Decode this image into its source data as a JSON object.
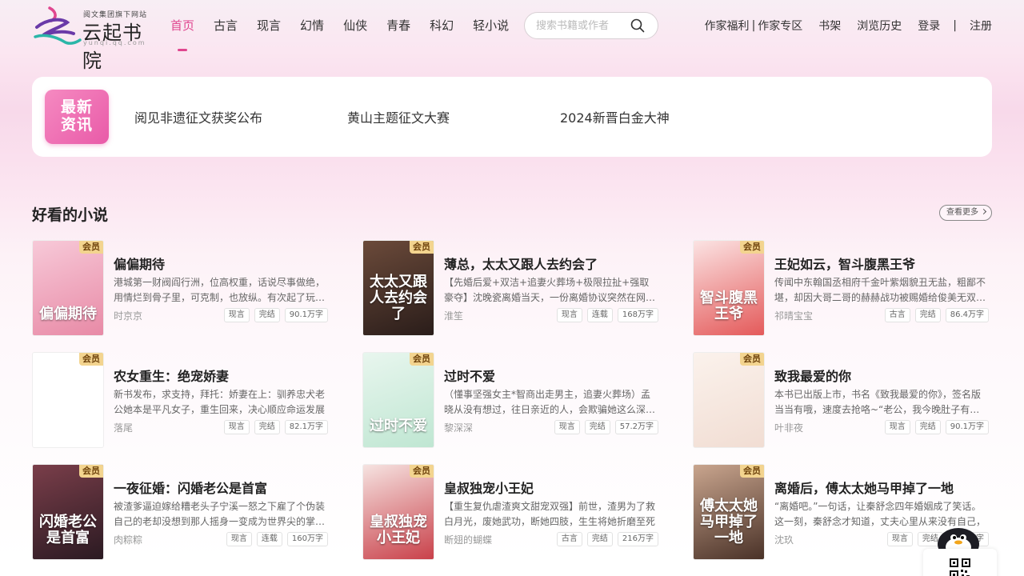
{
  "header": {
    "logo_tagline": "阅文集团旗下网站",
    "logo_brand": "云起书院",
    "logo_url": "yunqi.qq.com",
    "nav": [
      "首页",
      "古言",
      "现言",
      "幻情",
      "仙侠",
      "青春",
      "科幻",
      "轻小说"
    ],
    "active_nav": "首页",
    "search_placeholder": "搜索书籍或作者",
    "author_benefits": "作家福利",
    "author_zone": "作家专区",
    "pipe": "|",
    "bookshelf": "书架",
    "history": "浏览历史",
    "login": "登录",
    "register": "注册"
  },
  "news": {
    "badge_line1": "最新",
    "badge_line2": "资讯",
    "items": [
      "阅见非遗征文获奖公布",
      "黄山主题征文大赛",
      "2024新晋白金大神"
    ]
  },
  "section": {
    "title": "好看的小说",
    "more": "查看更多"
  },
  "vip_label": "会员",
  "books": [
    {
      "title": "偏偏期待",
      "cover_text": "偏偏期待",
      "desc": "港城第一财阀阎行洲，位高权重，话说尽事做绝，用情烂到骨子里，可克制，也放纵。有次起了玩心，",
      "author": "时京京",
      "tags": [
        "现言",
        "完结",
        "90.1万字"
      ],
      "cover_colors": [
        "#f7c9d8",
        "#e88aa6"
      ]
    },
    {
      "title": "薄总，太太又跟人去约会了",
      "cover_text": "太太又跟人去约会了",
      "desc": "【先婚后爱+双洁+追妻火葬场+极限拉扯+强取豪夺】沈晚瓷离婚当天，一份离婚协议突然在网络上曝光",
      "author": "淮笙",
      "tags": [
        "现言",
        "连载",
        "168万字"
      ],
      "cover_colors": [
        "#6b4a3a",
        "#2a1d1a"
      ]
    },
    {
      "title": "王妃如云，智斗腹黑王爷",
      "cover_text": "智斗腹黑王爷",
      "desc": "传闻中东翰国丞相府千金叶紫烟貌丑无盐，粗鄙不堪，却因大哥二哥的赫赫战功被赐婚给俊美无双的王爷",
      "author": "祁晴宝宝",
      "tags": [
        "古言",
        "完结",
        "86.4万字"
      ],
      "cover_colors": [
        "#fbe3e3",
        "#e45a5a"
      ]
    },
    {
      "title": "农女重生：绝宠娇妻",
      "cover_text": "",
      "desc": "新书发布，求支持，拜托：娇妻在上：驯养忠犬老公她本是平凡女子，重生回来，决心顺应命运发展",
      "author": "落尾",
      "tags": [
        "现言",
        "完结",
        "82.1万字"
      ],
      "cover_colors": [
        "#ffffff",
        "#ffffff"
      ]
    },
    {
      "title": "过时不爱",
      "cover_text": "过时不爱",
      "desc": "（懂事坚强女主*智商出走男主，追妻火葬场）孟晓从没有想过，往日亲近的人，会欺骗她这么深。初恋",
      "author": "黎深深",
      "tags": [
        "现言",
        "完结",
        "57.2万字"
      ],
      "cover_colors": [
        "#e8f6ee",
        "#bfe6d2"
      ]
    },
    {
      "title": "致我最爱的你",
      "cover_text": "",
      "desc": "本书已出版上市，书名《致我最爱的你》，签名版当当有哦，速度去抢咯~“老公，我今晚肚子有些疼”",
      "author": "叶非夜",
      "tags": [
        "现言",
        "完结",
        "90.1万字"
      ],
      "cover_colors": [
        "#fbf2ec",
        "#f1ddd3"
      ]
    },
    {
      "title": "一夜征婚：闪婚老公是首富",
      "cover_text": "闪婚老公是首富",
      "desc": "被渣爹逼迫嫁给糟老头子宁溪一怒之下雇了个伪装自己的老却没想到那人摇身一变成为世界尖的掌权者",
      "author": "肉粽粽",
      "tags": [
        "现言",
        "连载",
        "160万字"
      ],
      "cover_colors": [
        "#7a3e4a",
        "#2b1a22"
      ]
    },
    {
      "title": "皇叔独宠小王妃",
      "cover_text": "皇叔独宠小王妃",
      "desc": "【重生复仇虐渣爽文甜宠双强】前世，渣男为了救白月光，废她武功，断她四肢，生生将她折磨至死",
      "author": "断翅的蝴蝶",
      "tags": [
        "古言",
        "完结",
        "216万字"
      ],
      "cover_colors": [
        "#f6e3e1",
        "#c9414a"
      ]
    },
    {
      "title": "离婚后，傅太太她马甲掉了一地",
      "cover_text": "傅太太她马甲掉了一地",
      "desc": "“离婚吧。”一句话，让秦舒念四年婚姻成了笑话。这一刻，秦舒念才知道，丈夫心里从来没有自己，",
      "author": "沈玖",
      "tags": [
        "现言",
        "完结",
        "160万字"
      ],
      "cover_colors": [
        "#c9a58e",
        "#4a3228"
      ]
    }
  ]
}
